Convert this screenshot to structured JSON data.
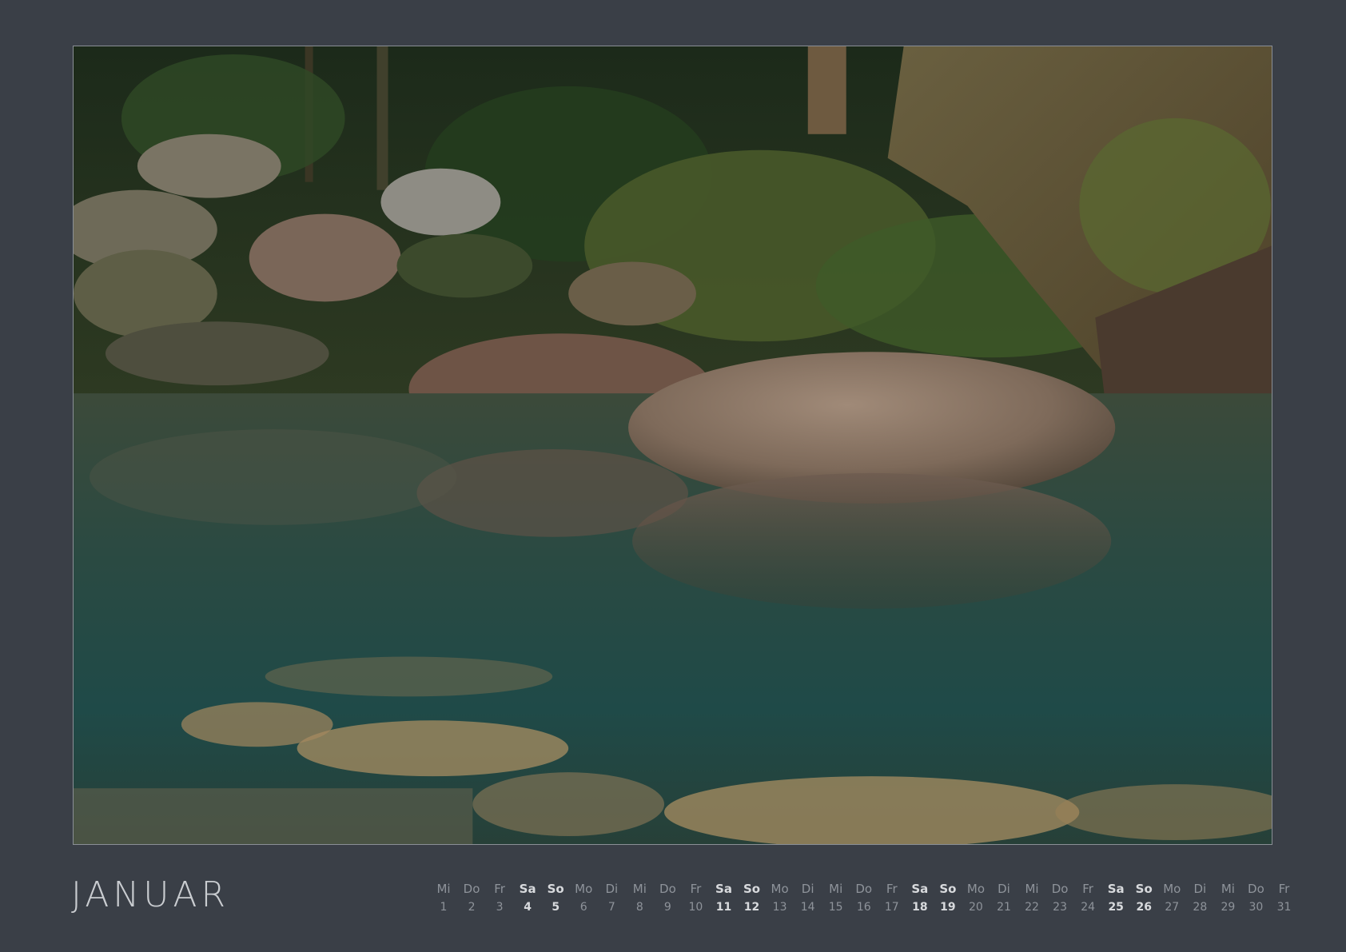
{
  "month": {
    "title": "JANUAR"
  },
  "calendar": {
    "days": [
      {
        "weekday": "Mi",
        "day": "1",
        "weekend": false
      },
      {
        "weekday": "Do",
        "day": "2",
        "weekend": false
      },
      {
        "weekday": "Fr",
        "day": "3",
        "weekend": false
      },
      {
        "weekday": "Sa",
        "day": "4",
        "weekend": true
      },
      {
        "weekday": "So",
        "day": "5",
        "weekend": true
      },
      {
        "weekday": "Mo",
        "day": "6",
        "weekend": false
      },
      {
        "weekday": "Di",
        "day": "7",
        "weekend": false
      },
      {
        "weekday": "Mi",
        "day": "8",
        "weekend": false
      },
      {
        "weekday": "Do",
        "day": "9",
        "weekend": false
      },
      {
        "weekday": "Fr",
        "day": "10",
        "weekend": false
      },
      {
        "weekday": "Sa",
        "day": "11",
        "weekend": true
      },
      {
        "weekday": "So",
        "day": "12",
        "weekend": true
      },
      {
        "weekday": "Mo",
        "day": "13",
        "weekend": false
      },
      {
        "weekday": "Di",
        "day": "14",
        "weekend": false
      },
      {
        "weekday": "Mi",
        "day": "15",
        "weekend": false
      },
      {
        "weekday": "Do",
        "day": "16",
        "weekend": false
      },
      {
        "weekday": "Fr",
        "day": "17",
        "weekend": false
      },
      {
        "weekday": "Sa",
        "day": "18",
        "weekend": true
      },
      {
        "weekday": "So",
        "day": "19",
        "weekend": true
      },
      {
        "weekday": "Mo",
        "day": "20",
        "weekend": false
      },
      {
        "weekday": "Di",
        "day": "21",
        "weekend": false
      },
      {
        "weekday": "Mi",
        "day": "22",
        "weekend": false
      },
      {
        "weekday": "Do",
        "day": "23",
        "weekend": false
      },
      {
        "weekday": "Fr",
        "day": "24",
        "weekend": false
      },
      {
        "weekday": "Sa",
        "day": "25",
        "weekend": true
      },
      {
        "weekday": "So",
        "day": "26",
        "weekend": true
      },
      {
        "weekday": "Mo",
        "day": "27",
        "weekend": false
      },
      {
        "weekday": "Di",
        "day": "28",
        "weekend": false
      },
      {
        "weekday": "Mi",
        "day": "29",
        "weekend": false
      },
      {
        "weekday": "Do",
        "day": "30",
        "weekend": false
      },
      {
        "weekday": "Fr",
        "day": "31",
        "weekend": false
      }
    ]
  },
  "colors": {
    "background": "#3a3f47",
    "text_regular": "#8e939a",
    "text_weekend": "#d8dadd",
    "title": "#c9ccd0"
  }
}
